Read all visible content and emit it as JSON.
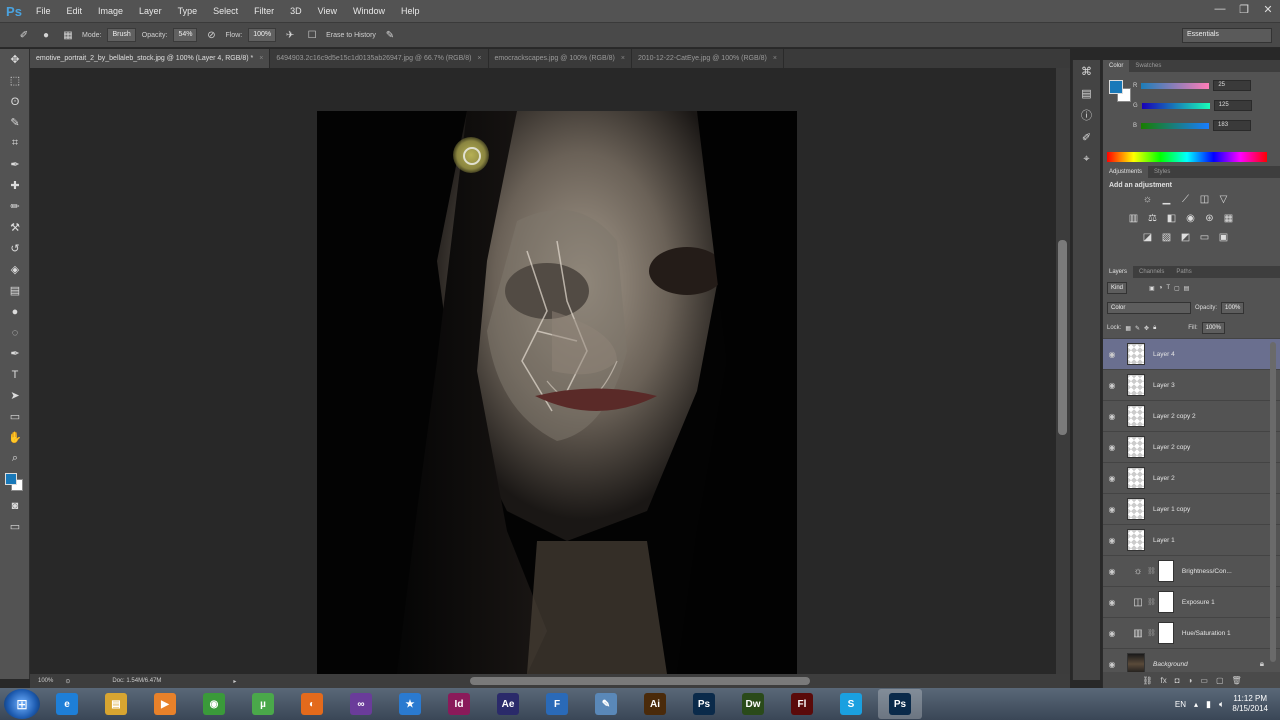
{
  "app": {
    "logo": "Ps"
  },
  "menu": [
    "File",
    "Edit",
    "Image",
    "Layer",
    "Type",
    "Select",
    "Filter",
    "3D",
    "View",
    "Window",
    "Help"
  ],
  "window_controls": {
    "minimize": "—",
    "restore": "❐",
    "close": "✕"
  },
  "options_bar": {
    "mode_label": "Mode:",
    "mode_value": "Brush",
    "opacity_label": "Opacity:",
    "opacity_value": "54%",
    "flow_label": "Flow:",
    "flow_value": "100%",
    "erase_to_history": "Erase to History",
    "workspace": "Essentials"
  },
  "doc_tabs": [
    {
      "label": "emotive_portrait_2_by_bellaleb_stock.jpg @ 100% (Layer 4, RGB/8) *",
      "active": true
    },
    {
      "label": "6494903.2c16c9d5e15c1d0135ab26947.jpg @ 66.7% (RGB/8)",
      "active": false
    },
    {
      "label": "emocrackscapes.jpg @ 100% (RGB/8)",
      "active": false
    },
    {
      "label": "2010-12-22-CatEye.jpg @ 100% (RGB/8)",
      "active": false
    }
  ],
  "status": {
    "zoom": "100%",
    "doc": "Doc: 1.54M/6.47M"
  },
  "color_panel": {
    "tabs": [
      "Color",
      "Swatches"
    ],
    "r_label": "R",
    "r_value": "25",
    "g_label": "G",
    "g_value": "125",
    "b_label": "B",
    "b_value": "183",
    "fg_color": "#1979b9",
    "bg_color": "#ffffff"
  },
  "adjustments": {
    "tabs": [
      "Adjustments",
      "Styles"
    ],
    "title": "Add an adjustment"
  },
  "layers_panel": {
    "tabs": [
      "Layers",
      "Channels",
      "Paths"
    ],
    "kind_label": "Kind",
    "blend_mode": "Color",
    "opacity_label": "Opacity:",
    "opacity_value": "100%",
    "lock_label": "Lock:",
    "fill_label": "Fill:",
    "fill_value": "100%",
    "layers": [
      {
        "name": "Layer 4",
        "selected": true,
        "type": "pixel"
      },
      {
        "name": "Layer 3",
        "selected": false,
        "type": "pixel"
      },
      {
        "name": "Layer 2 copy 2",
        "selected": false,
        "type": "pixel"
      },
      {
        "name": "Layer 2 copy",
        "selected": false,
        "type": "pixel"
      },
      {
        "name": "Layer 2",
        "selected": false,
        "type": "pixel"
      },
      {
        "name": "Layer 1 copy",
        "selected": false,
        "type": "pixel"
      },
      {
        "name": "Layer 1",
        "selected": false,
        "type": "pixel"
      },
      {
        "name": "Brightness/Con...",
        "selected": false,
        "type": "adjustment",
        "icon": "sun-icon"
      },
      {
        "name": "Exposure 1",
        "selected": false,
        "type": "adjustment",
        "icon": "exposure-icon"
      },
      {
        "name": "Hue/Saturation 1",
        "selected": false,
        "type": "adjustment",
        "icon": "hue-icon"
      },
      {
        "name": "Background",
        "selected": false,
        "type": "background"
      }
    ]
  },
  "taskbar": {
    "apps": [
      {
        "name": "ie",
        "label": "e",
        "color": "#1e7fd8"
      },
      {
        "name": "explorer",
        "label": "▤",
        "color": "#d8a531"
      },
      {
        "name": "media-player",
        "label": "▶",
        "color": "#e8812a"
      },
      {
        "name": "chrome",
        "label": "◉",
        "color": "#3a9a3a"
      },
      {
        "name": "utorrent",
        "label": "µ",
        "color": "#4aa84a"
      },
      {
        "name": "firefox",
        "label": "◐",
        "color": "#e36a1c"
      },
      {
        "name": "visual-studio",
        "label": "∞",
        "color": "#6a3c9a"
      },
      {
        "name": "star-app",
        "label": "★",
        "color": "#2a7ad0"
      },
      {
        "name": "indesign",
        "label": "Id",
        "color": "#8a1a5a"
      },
      {
        "name": "after-effects",
        "label": "Ae",
        "color": "#2a2a6a"
      },
      {
        "name": "fireworks-f",
        "label": "F",
        "color": "#2a6ab8"
      },
      {
        "name": "paint",
        "label": "✎",
        "color": "#5a88b8"
      },
      {
        "name": "illustrator",
        "label": "Ai",
        "color": "#4a2a0a"
      },
      {
        "name": "photoshop-1",
        "label": "Ps",
        "color": "#0a2a4a"
      },
      {
        "name": "dreamweaver",
        "label": "Dw",
        "color": "#2a4a1a"
      },
      {
        "name": "flash",
        "label": "Fl",
        "color": "#5a0a0a"
      },
      {
        "name": "skype",
        "label": "S",
        "color": "#1aa0e0"
      },
      {
        "name": "photoshop-2",
        "label": "Ps",
        "color": "#0a2a4a",
        "active": true
      }
    ],
    "lang": "EN",
    "time": "11:12 PM",
    "date": "8/15/2014"
  }
}
